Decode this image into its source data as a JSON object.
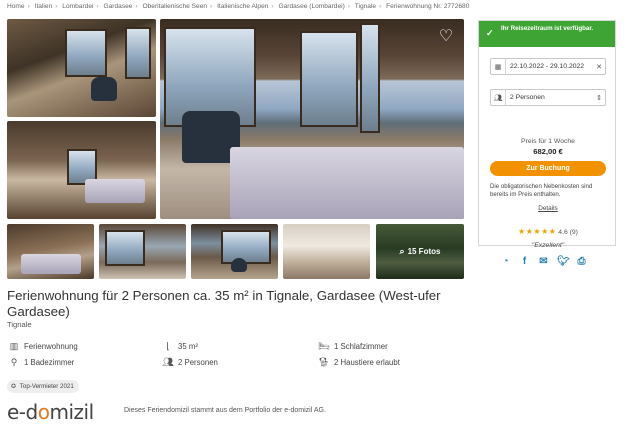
{
  "breadcrumb": [
    "Home",
    "Italien",
    "Lombardei",
    "Gardasee",
    "Oberitalienische Seen",
    "Italienische Alpen",
    "Gardasee (Lombardei)",
    "Tignale",
    "Ferienwohnung Nr. 2772680"
  ],
  "gallery": {
    "more_photos_label": "15 Fotos",
    "favorite_icon": "heart-outline-icon"
  },
  "booking": {
    "availability": "Ihr Reisezeitraum ist verfügbar.",
    "dates": "22.10.2022 - 29.10.2022",
    "persons": "2 Personen",
    "price_label": "Preis für 1 Woche",
    "price": "682,00 €",
    "book_button": "Zur Buchung",
    "note": "Die obligatorischen Nebenkosten sind bereits im Preis enthalten.",
    "details_link": "Details",
    "rating_score": "4.6",
    "rating_count": "(9)",
    "rating_word": "\"Exzellent\"",
    "rating_stars": 4.6
  },
  "listing": {
    "title": "Ferienwohnung für 2 Personen ca. 35 m² in Tignale, Gardasee (West-ufer Gardasee)",
    "location": "Tignale"
  },
  "features": {
    "type": "Ferienwohnung",
    "area": "35 m²",
    "bedrooms": "1 Schlafzimmer",
    "bathrooms": "1 Badezimmer",
    "guests": "2 Personen",
    "pets": "2 Haustiere erlaubt"
  },
  "badge": "Top-Vermieter 2021",
  "footer": {
    "logo_left": "e-d",
    "logo_o": "o",
    "logo_right": "mizil",
    "portfolio_text": "Dieses Feriendomizil stammt aus dem Portfolio der e-domizil AG."
  },
  "colors": {
    "green": "#3ea534",
    "orange": "#f39200",
    "share_blue": "#2a7fa6",
    "star": "#e8a400"
  }
}
